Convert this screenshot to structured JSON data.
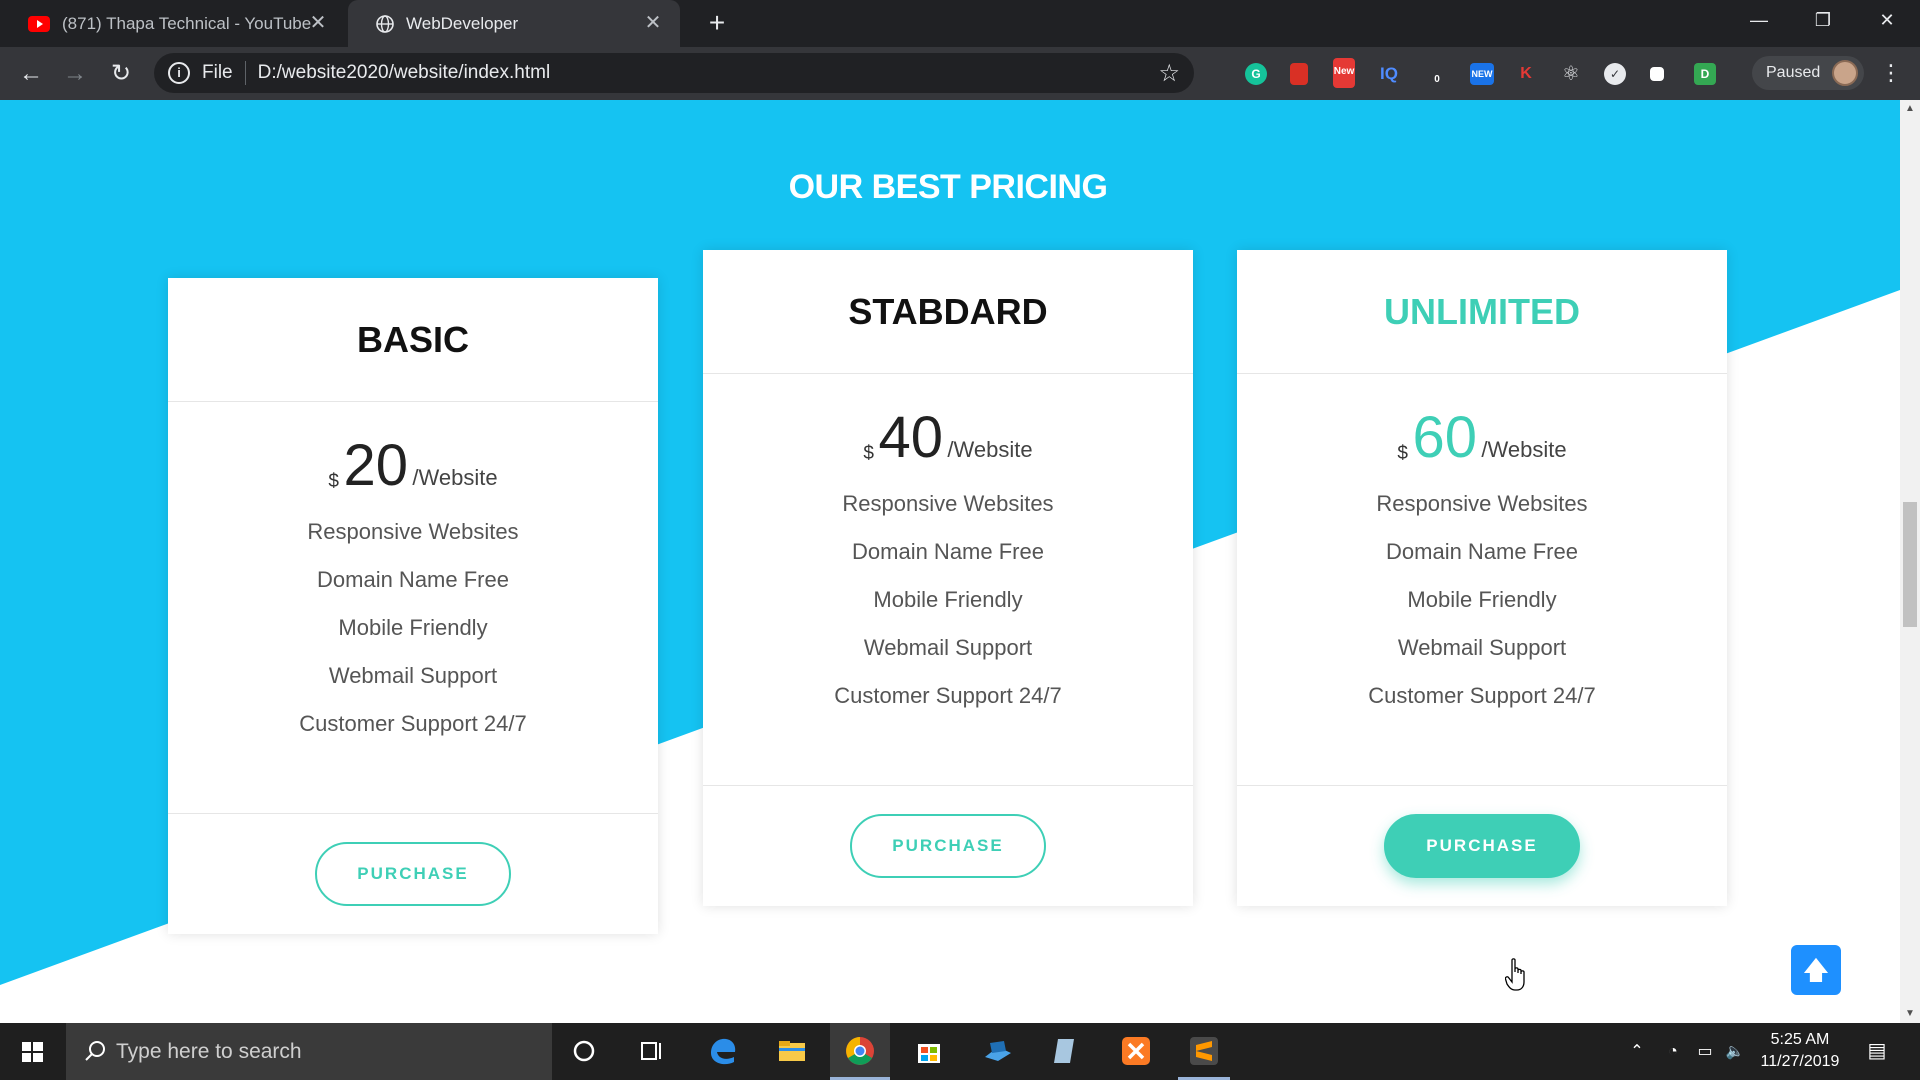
{
  "browser": {
    "tabs": [
      {
        "label": "(871) Thapa Technical - YouTube",
        "active": false,
        "favicon": "youtube-icon"
      },
      {
        "label": "WebDeveloper",
        "active": true,
        "favicon": "globe-icon"
      }
    ],
    "address": {
      "protocol": "File",
      "url": "D:/website2020/website/index.html"
    },
    "profile": {
      "status": "Paused"
    },
    "extensions": [
      "grammarly-icon",
      "bookmark-ext-icon",
      "new-badge-ext-icon",
      "iq-ext-icon",
      "counter-ext-icon",
      "new-ext-icon",
      "k-ext-icon",
      "react-ext-icon",
      "circle-ext-icon",
      "square-ext-icon",
      "d-ext-icon"
    ],
    "extension_labels": {
      "iq": "IQ",
      "new": "NEW",
      "new_badge": "New",
      "counter": "0",
      "k": "K",
      "d": "D"
    }
  },
  "page": {
    "section_title": "OUR BEST PRICING",
    "colors": {
      "background": "#15c3f2",
      "accent": "#3ecfb6",
      "to_top": "#1e90ff"
    },
    "plans": [
      {
        "name": "BASIC",
        "currency": "$",
        "amount": "20",
        "period": "/Website",
        "features": [
          "Responsive Websites",
          "Domain Name Free",
          "Mobile Friendly",
          "Webmail Support",
          "Customer Support 24/7"
        ],
        "button": "PURCHASE",
        "highlighted": false
      },
      {
        "name": "STABDARD",
        "currency": "$",
        "amount": "40",
        "period": "/Website",
        "features": [
          "Responsive Websites",
          "Domain Name Free",
          "Mobile Friendly",
          "Webmail Support",
          "Customer Support 24/7"
        ],
        "button": "PURCHASE",
        "highlighted": false
      },
      {
        "name": "UNLIMITED",
        "currency": "$",
        "amount": "60",
        "period": "/Website",
        "features": [
          "Responsive Websites",
          "Domain Name Free",
          "Mobile Friendly",
          "Webmail Support",
          "Customer Support 24/7"
        ],
        "button": "PURCHASE",
        "highlighted": true
      }
    ]
  },
  "taskbar": {
    "search_placeholder": "Type here to search",
    "time": "5:25 AM",
    "date": "11/27/2019"
  }
}
